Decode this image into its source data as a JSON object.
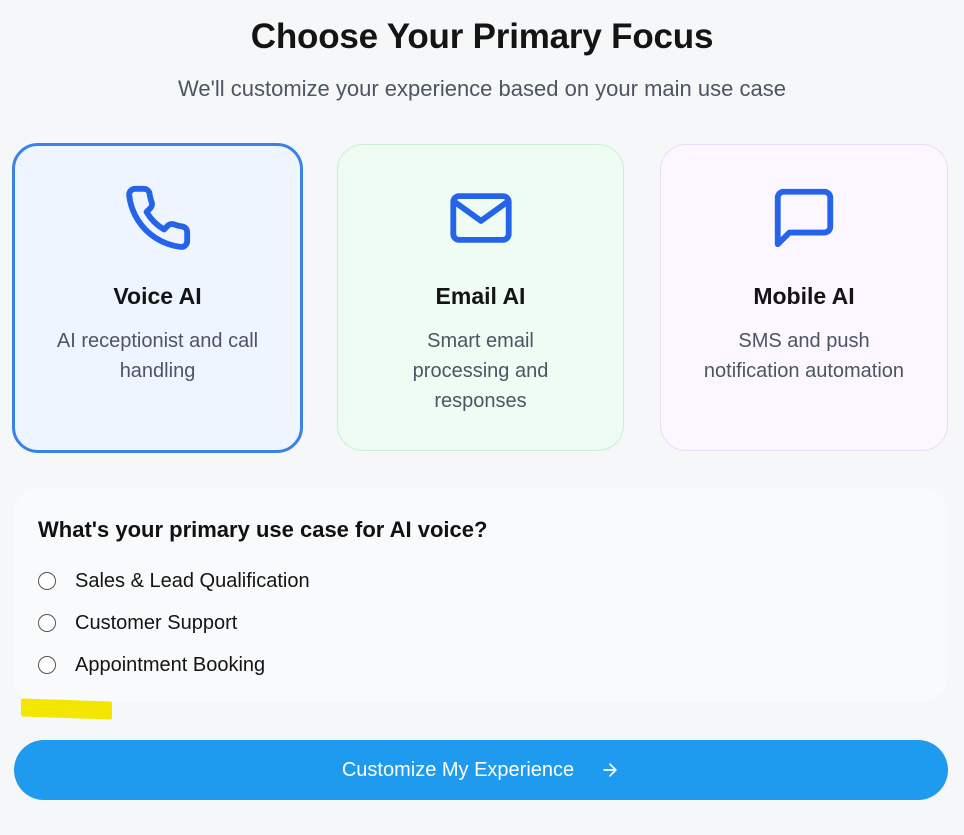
{
  "header": {
    "title": "Choose Your Primary Focus",
    "subtitle": "We'll customize your experience based on your main use case"
  },
  "cards": [
    {
      "id": "voice",
      "name": "Voice AI",
      "description": "AI receptionist and call handling",
      "icon": "phone-icon",
      "selected": true
    },
    {
      "id": "email",
      "name": "Email AI",
      "description": "Smart email processing and responses",
      "icon": "mail-icon",
      "selected": false
    },
    {
      "id": "mobile",
      "name": "Mobile AI",
      "description": "SMS and push notification automation",
      "icon": "chat-bubble-icon",
      "selected": false
    }
  ],
  "use_case": {
    "question": "What's your primary use case for AI voice?",
    "options": [
      {
        "label": "Sales & Lead Qualification",
        "checked": false
      },
      {
        "label": "Customer Support",
        "checked": false
      },
      {
        "label": "Appointment Booking",
        "checked": false
      }
    ]
  },
  "cta": {
    "label": "Customize My Experience",
    "icon": "arrow-right-icon"
  },
  "colors": {
    "accent": "#1e9bef",
    "icon_blue": "#2563eb",
    "selected_border": "#3b82e8",
    "highlight_marker": "#f3e600"
  }
}
